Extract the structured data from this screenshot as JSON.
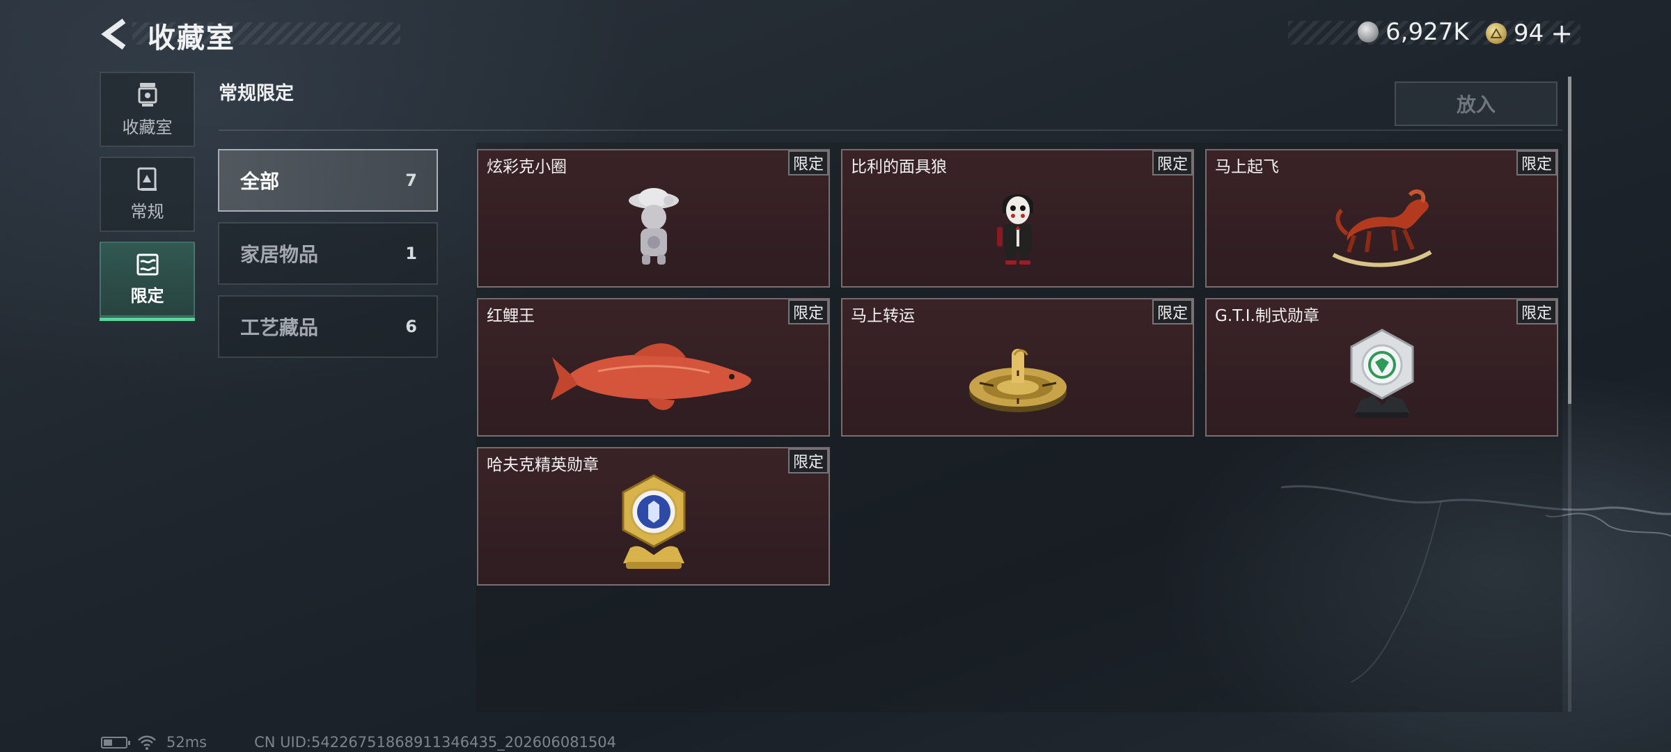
{
  "header": {
    "title": "收藏室",
    "currency_silver": "6,927K",
    "currency_gold": "94",
    "currency_add": "+"
  },
  "sidebar": {
    "items": [
      {
        "label": "收藏室",
        "icon": "trophy-icon",
        "active": false
      },
      {
        "label": "常规",
        "icon": "book-icon",
        "active": false
      },
      {
        "label": "限定",
        "icon": "image-icon",
        "active": true
      }
    ]
  },
  "section": {
    "title": "常规限定",
    "put_button": "放入"
  },
  "categories": [
    {
      "name": "全部",
      "count": "7",
      "active": true
    },
    {
      "name": "家居物品",
      "count": "1",
      "active": false
    },
    {
      "name": "工艺藏品",
      "count": "6",
      "active": false
    }
  ],
  "items": [
    {
      "name": "炫彩克小圈",
      "tag": "限定",
      "icon": "doll-figurine-icon"
    },
    {
      "name": "比利的面具狼",
      "tag": "限定",
      "icon": "puppet-figure-icon"
    },
    {
      "name": "马上起飞",
      "tag": "限定",
      "icon": "rocking-horse-icon"
    },
    {
      "name": "红鲤王",
      "tag": "限定",
      "icon": "carp-fish-icon"
    },
    {
      "name": "马上转运",
      "tag": "限定",
      "icon": "gold-disc-icon"
    },
    {
      "name": "G.T.I.制式勋章",
      "tag": "限定",
      "icon": "silver-medal-icon"
    },
    {
      "name": "哈夫克精英勋章",
      "tag": "限定",
      "icon": "gold-medal-icon"
    }
  ],
  "footer": {
    "ping": "52ms",
    "uid": "CN UID:54226751868911346435_202606081504"
  },
  "colors": {
    "accent_green": "#5fd39a",
    "card_bg": "#3a2327"
  }
}
